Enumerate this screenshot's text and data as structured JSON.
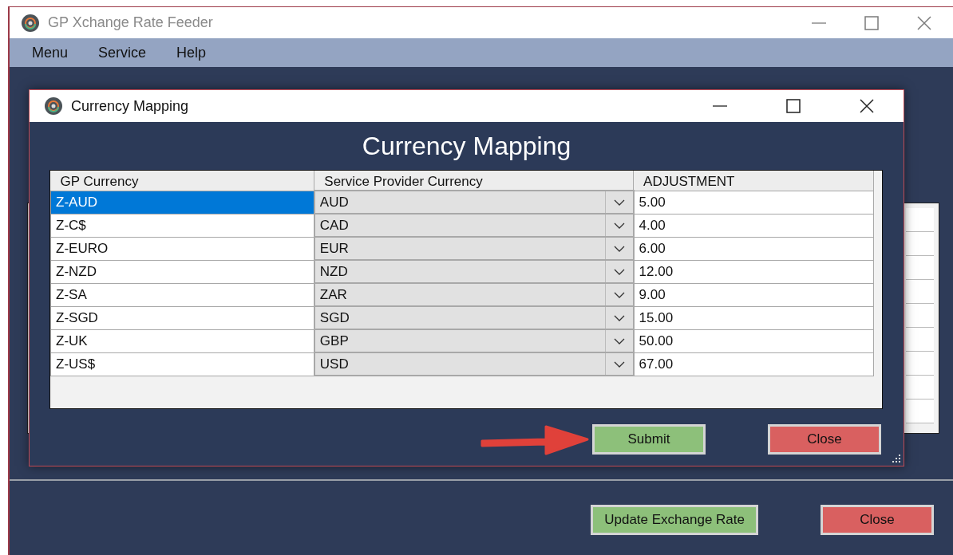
{
  "main_window": {
    "title": "GP Xchange Rate Feeder",
    "menu": [
      "Menu",
      "Service",
      "Help"
    ],
    "buttons": [
      {
        "label": "Update Exchange Rate",
        "kind": "primary"
      },
      {
        "label": "Close",
        "kind": "danger"
      }
    ]
  },
  "dialog": {
    "title": "Currency Mapping",
    "heading": "Currency Mapping",
    "table": {
      "columns": [
        "GP Currency",
        "Service Provider Currency",
        "ADJUSTMENT"
      ],
      "rows": [
        {
          "gp_currency": "Z-AUD",
          "provider_currency": "AUD",
          "adjustment": "5.00",
          "selected": true
        },
        {
          "gp_currency": "Z-C$",
          "provider_currency": "CAD",
          "adjustment": "4.00",
          "selected": false
        },
        {
          "gp_currency": "Z-EURO",
          "provider_currency": "EUR",
          "adjustment": "6.00",
          "selected": false
        },
        {
          "gp_currency": "Z-NZD",
          "provider_currency": "NZD",
          "adjustment": "12.00",
          "selected": false
        },
        {
          "gp_currency": "Z-SA",
          "provider_currency": "ZAR",
          "adjustment": "9.00",
          "selected": false
        },
        {
          "gp_currency": "Z-SGD",
          "provider_currency": "SGD",
          "adjustment": "15.00",
          "selected": false
        },
        {
          "gp_currency": "Z-UK",
          "provider_currency": "GBP",
          "adjustment": "50.00",
          "selected": false
        },
        {
          "gp_currency": "Z-US$",
          "provider_currency": "USD",
          "adjustment": "67.00",
          "selected": false
        }
      ]
    },
    "buttons": [
      {
        "label": "Submit",
        "kind": "primary"
      },
      {
        "label": "Close",
        "kind": "danger"
      }
    ]
  }
}
